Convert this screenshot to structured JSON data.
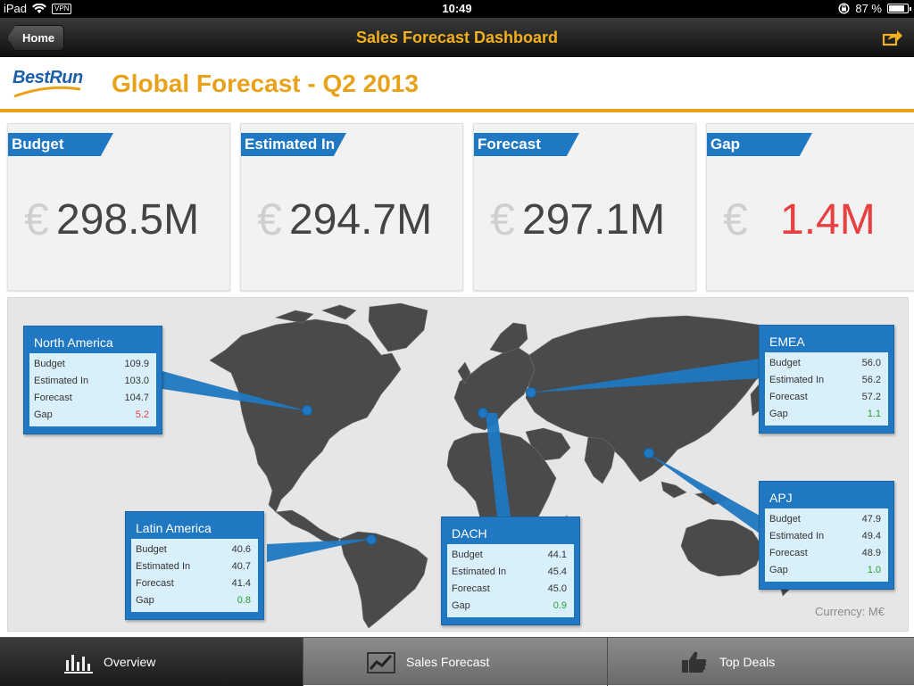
{
  "status": {
    "device": "iPad",
    "vpn": "VPN",
    "time": "10:49",
    "battery": "87 %",
    "battery_level": 0.87
  },
  "nav": {
    "home_label": "Home",
    "title": "Sales Forecast Dashboard"
  },
  "header": {
    "logo_text": "BestRun",
    "title": "Global Forecast - Q2 2013"
  },
  "kpis": [
    {
      "label": "Budget",
      "currency": "€",
      "value": "298.5M"
    },
    {
      "label": "Estimated In",
      "currency": "€",
      "value": "294.7M"
    },
    {
      "label": "Forecast",
      "currency": "€",
      "value": "297.1M"
    },
    {
      "label": "Gap",
      "currency": "€",
      "value": "1.4M"
    }
  ],
  "regions": {
    "north_america": {
      "name": "North America",
      "rows": [
        {
          "label": "Budget",
          "value": "109.9"
        },
        {
          "label": "Estimated In",
          "value": "103.0"
        },
        {
          "label": "Forecast",
          "value": "104.7"
        },
        {
          "label": "Gap",
          "value": "5.2"
        }
      ]
    },
    "latin_america": {
      "name": "Latin America",
      "rows": [
        {
          "label": "Budget",
          "value": "40.6"
        },
        {
          "label": "Estimated In",
          "value": "40.7"
        },
        {
          "label": "Forecast",
          "value": "41.4"
        },
        {
          "label": "Gap",
          "value": "0.8"
        }
      ]
    },
    "dach": {
      "name": "DACH",
      "rows": [
        {
          "label": "Budget",
          "value": "44.1"
        },
        {
          "label": "Estimated In",
          "value": "45.4"
        },
        {
          "label": "Forecast",
          "value": "45.0"
        },
        {
          "label": "Gap",
          "value": "0.9"
        }
      ]
    },
    "emea": {
      "name": "EMEA",
      "rows": [
        {
          "label": "Budget",
          "value": "56.0"
        },
        {
          "label": "Estimated In",
          "value": "56.2"
        },
        {
          "label": "Forecast",
          "value": "57.2"
        },
        {
          "label": "Gap",
          "value": "1.1"
        }
      ]
    },
    "apj": {
      "name": "APJ",
      "rows": [
        {
          "label": "Budget",
          "value": "47.9"
        },
        {
          "label": "Estimated In",
          "value": "49.4"
        },
        {
          "label": "Forecast",
          "value": "48.9"
        },
        {
          "label": "Gap",
          "value": "1.0"
        }
      ]
    }
  },
  "currency_note": "Currency: M€",
  "tabs": [
    {
      "label": "Overview",
      "icon": "bar-chart-icon"
    },
    {
      "label": "Sales Forecast",
      "icon": "line-chart-icon"
    },
    {
      "label": "Top Deals",
      "icon": "thumbs-up-icon"
    }
  ],
  "colors": {
    "accent": "#e8a21a",
    "blue": "#1f78c1",
    "negative": "#e84040",
    "positive": "#2a9d2a"
  }
}
